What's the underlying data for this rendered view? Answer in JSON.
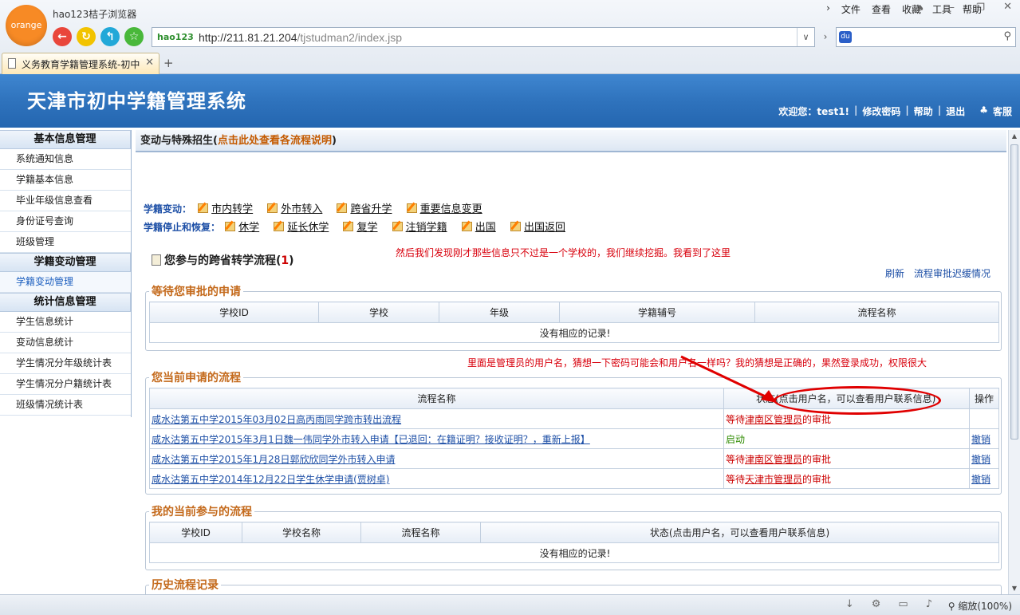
{
  "browser": {
    "logo_text": "orange",
    "name": "hao123桔子浏览器",
    "menu": [
      "文件",
      "查看",
      "收藏",
      "工具",
      "帮助"
    ],
    "address_badge": "hao123",
    "url_host": "http://211.81.21.204",
    "url_path": "/tjstudman2/index.jsp",
    "tab_title": "义务教育学籍管理系统-初中",
    "zoom": "缩放(100%)"
  },
  "header": {
    "title": "天津市初中学籍管理系统",
    "welcome": "欢迎您：test1!",
    "change_password": "修改密码",
    "help": "帮助",
    "logout": "退出",
    "service": "客服"
  },
  "sidebar": {
    "sections": [
      {
        "title": "基本信息管理",
        "items": [
          "系统通知信息",
          "学籍基本信息",
          "毕业年级信息查看",
          "身份证号查询",
          "班级管理"
        ]
      },
      {
        "title": "学籍变动管理",
        "items": [
          "学籍变动管理"
        ]
      },
      {
        "title": "统计信息管理",
        "items": [
          "学生信息统计",
          "变动信息统计",
          "学生情况分年级统计表",
          "学生情况分户籍统计表",
          "班级情况统计表"
        ]
      }
    ]
  },
  "main": {
    "title": "变动与特殊招生(",
    "title_link": "点击此处查看各流程说明",
    "title_end": ")",
    "change_label": "学籍变动：",
    "change_links": [
      "市内转学",
      "外市转入",
      "跨省升学",
      "重要信息变更"
    ],
    "stop_label": "学籍停止和恢复：",
    "stop_links": [
      "休学",
      "延长休学",
      "复学",
      "注销学籍",
      "出国",
      "出国返回"
    ],
    "cross_title": "您参与的跨省转学流程(",
    "cross_count": "1",
    "cross_end": ")",
    "refresh": "刷新",
    "delay_link": "流程审批迟缓情况",
    "annotation1": "然后我们发现刚才那些信息只不过是一个学校的，我们继续挖掘。我看到了这里",
    "annotation2": "里面是管理员的用户名，猜想一下密码可能会和用户名一样吗？我的猜想是正确的，果然登录成功，权限很大",
    "pending": {
      "legend": "等待您审批的申请",
      "headers": [
        "学校ID",
        "学校",
        "年级",
        "学籍辅号",
        "流程名称"
      ],
      "empty": "没有相应的记录!"
    },
    "current": {
      "legend": "您当前申请的流程",
      "headers": [
        "流程名称",
        "状态(点击用户名，可以查看用户联系信息)",
        "操作"
      ],
      "rows": [
        {
          "name": "咸水沽第五中学2015年03月02日高丙雨同学跨市转出流程",
          "status_pre": "等待",
          "status_link": "津南区管理员",
          "status_post": "的审批",
          "status_kind": "red",
          "op": ""
        },
        {
          "name": "咸水沽第五中学2015年3月1日魏一伟同学外市转入申请【已退回：在籍证明？接收证明？，重新上报】",
          "status_pre": "启动",
          "status_link": "",
          "status_post": "",
          "status_kind": "green",
          "op": "撤销"
        },
        {
          "name": "咸水沽第五中学2015年1月28日郭欣欣同学外市转入申请",
          "status_pre": "等待",
          "status_link": "津南区管理员",
          "status_post": "的审批",
          "status_kind": "red",
          "op": "撤销"
        },
        {
          "name": "咸水沽第五中学2014年12月22日学生休学申请(贾树卓)",
          "status_pre": "等待",
          "status_link": "天津市管理员",
          "status_post": "的审批",
          "status_kind": "red",
          "op": "撤销"
        }
      ]
    },
    "participated": {
      "legend": "我的当前参与的流程",
      "headers": [
        "学校ID",
        "学校名称",
        "流程名称",
        "状态(点击用户名，可以查看用户联系信息)"
      ],
      "empty": "没有相应的记录!"
    },
    "history": {
      "legend": "历史流程记录"
    }
  }
}
